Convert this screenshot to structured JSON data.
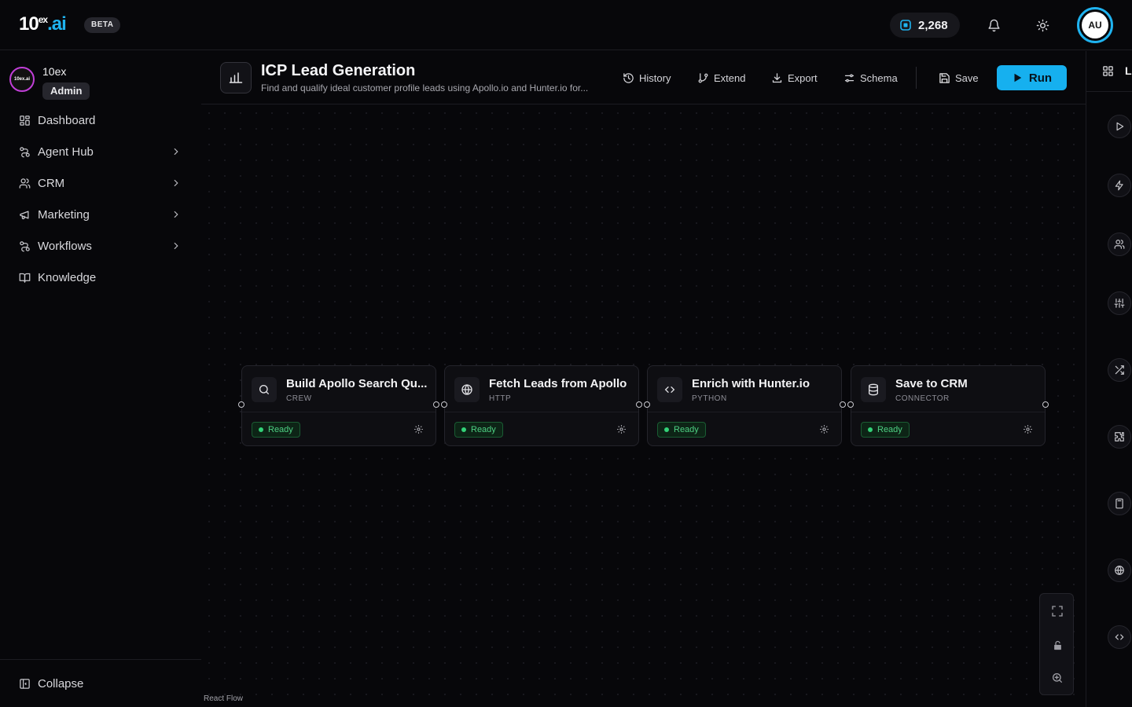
{
  "app": {
    "logo": {
      "main": "10",
      "sup": "ex",
      "suffix": ".ai"
    },
    "beta_label": "BETA",
    "credits": "2,268",
    "avatar_initials": "AU",
    "accent_color": "#16b0ef"
  },
  "sidebar": {
    "org_logo_text": "10ex.ai",
    "org_name": "10ex",
    "role": "Admin",
    "items": [
      {
        "label": "Dashboard",
        "icon": "dashboard-icon",
        "has_children": false
      },
      {
        "label": "Agent Hub",
        "icon": "workflow-icon",
        "has_children": true
      },
      {
        "label": "CRM",
        "icon": "users-icon",
        "has_children": true
      },
      {
        "label": "Marketing",
        "icon": "megaphone-icon",
        "has_children": true
      },
      {
        "label": "Workflows",
        "icon": "workflow-icon",
        "has_children": true
      },
      {
        "label": "Knowledge",
        "icon": "book-icon",
        "has_children": false
      }
    ],
    "collapse_label": "Collapse"
  },
  "workflow": {
    "title": "ICP Lead Generation",
    "description": "Find and qualify ideal customer profile leads using Apollo.io and Hunter.io for...",
    "actions": {
      "history": "History",
      "extend": "Extend",
      "export": "Export",
      "schema": "Schema",
      "save": "Save",
      "run": "Run"
    }
  },
  "nodes": [
    {
      "title": "Build Apollo Search Qu...",
      "type": "CREW",
      "status": "Ready",
      "icon": "search-icon"
    },
    {
      "title": "Fetch Leads from Apollo",
      "type": "HTTP",
      "status": "Ready",
      "icon": "globe-icon"
    },
    {
      "title": "Enrich with Hunter.io",
      "type": "PYTHON",
      "status": "Ready",
      "icon": "code-icon"
    },
    {
      "title": "Save to CRM",
      "type": "CONNECTOR",
      "status": "Ready",
      "icon": "database-icon"
    }
  ],
  "canvas": {
    "attribution": "React Flow"
  },
  "rail": {
    "header_label": "Li",
    "buttons": [
      "play-icon",
      "lightning-icon",
      "users-icon",
      "sliders-icon",
      "shuffle-icon",
      "puzzle-icon",
      "calculator-icon",
      "globe-icon",
      "code-icon"
    ]
  }
}
